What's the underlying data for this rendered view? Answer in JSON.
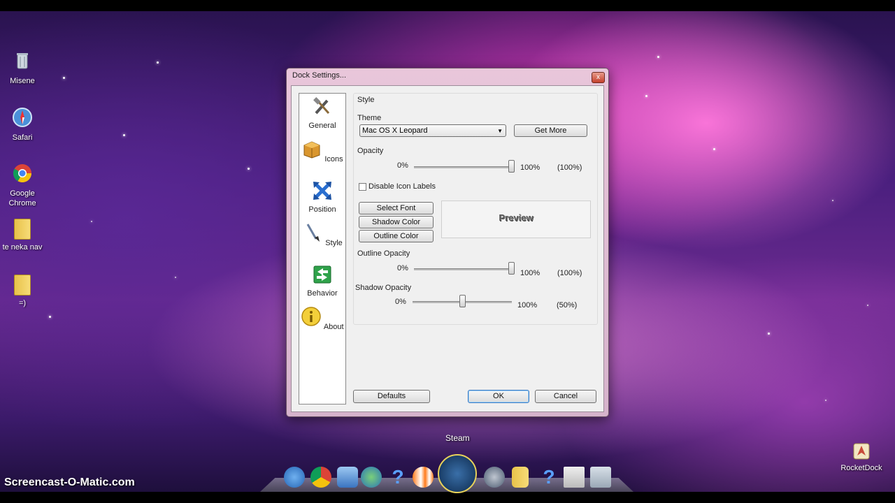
{
  "desktop": {
    "icons": [
      {
        "label": "Misene",
        "icon": "recycle-bin-icon"
      },
      {
        "label": "Safari",
        "icon": "safari-icon"
      },
      {
        "label": "Google Chrome",
        "icon": "chrome-icon"
      },
      {
        "label": "te neka nav",
        "icon": "folder-icon"
      },
      {
        "label": "=)",
        "icon": "folder-icon"
      }
    ],
    "rocketdock_label": "RocketDock",
    "watermark": "Screencast-O-Matic.com",
    "dock_hover_label": "Steam",
    "dock_icons": [
      "safari-icon",
      "chrome-icon",
      "computer-icon",
      "network-icon",
      "help-icon",
      "clownfish-icon",
      "steam-icon",
      "itunes-icon",
      "folder-icon",
      "help-icon",
      "counter-strike-icon",
      "recycle-bin-icon"
    ]
  },
  "dialog": {
    "title": "Dock Settings...",
    "close_glyph": "x",
    "sidebar": [
      {
        "label": "General",
        "icon": "tools-icon"
      },
      {
        "label": "Icons",
        "icon": "box-icon"
      },
      {
        "label": "Position",
        "icon": "arrows-icon"
      },
      {
        "label": "Style",
        "icon": "brush-icon"
      },
      {
        "label": "Behavior",
        "icon": "behavior-arrows-icon"
      },
      {
        "label": "About",
        "icon": "info-icon"
      }
    ],
    "style": {
      "section_title": "Style",
      "theme_label": "Theme",
      "theme_value": "Mac OS X Leopard",
      "get_more_button": "Get More",
      "opacity_label": "Opacity",
      "opacity_min": "0%",
      "opacity_max": "100%",
      "opacity_current": "(100%)",
      "opacity_level": 1.0,
      "disable_icon_labels": "Disable Icon Labels",
      "disable_icon_labels_checked": false,
      "select_font_button": "Select Font",
      "shadow_color_button": "Shadow Color",
      "outline_color_button": "Outline Color",
      "preview_text": "Preview",
      "outline_opacity_label": "Outline Opacity",
      "outline_opacity_min": "0%",
      "outline_opacity_max": "100%",
      "outline_opacity_current": "(100%)",
      "outline_opacity_level": 1.0,
      "shadow_opacity_label": "Shadow Opacity",
      "shadow_opacity_min": "0%",
      "shadow_opacity_max": "100%",
      "shadow_opacity_current": "(50%)",
      "shadow_opacity_level": 0.5
    },
    "buttons": {
      "defaults": "Defaults",
      "ok": "OK",
      "cancel": "Cancel"
    }
  }
}
